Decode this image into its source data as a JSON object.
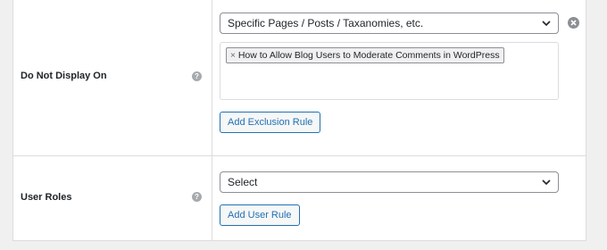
{
  "rows": [
    {
      "label": "Do Not Display On",
      "help_icon": "question-icon",
      "select_value": "Specific Pages / Posts / Taxanomies, etc.",
      "tags": [
        {
          "label": "How to Allow Blog Users to Moderate Comments in WordPress",
          "remove_glyph": "×"
        }
      ],
      "button_label": "Add Exclusion Rule",
      "remove_icon": "close-circle-icon"
    },
    {
      "label": "User Roles",
      "help_icon": "question-icon",
      "select_value": "Select",
      "button_label": "Add User Rule"
    }
  ],
  "colors": {
    "accent": "#2271b1",
    "text": "#1d2327",
    "border": "#8c8f94",
    "background": "#f0f0f1"
  }
}
